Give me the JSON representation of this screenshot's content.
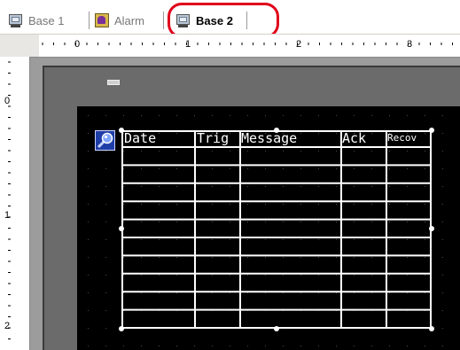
{
  "tabs": [
    {
      "label": "Base 1",
      "icon": "screen-icon",
      "active": false
    },
    {
      "label": "Alarm",
      "icon": "alarm-icon",
      "active": false
    },
    {
      "label": "Base 2",
      "icon": "screen-icon",
      "active": true
    }
  ],
  "ruler": {
    "horizontal_labels": [
      "0",
      "1",
      "2",
      "3"
    ],
    "vertical_labels": [
      "0",
      "1",
      "2"
    ]
  },
  "alarm_table": {
    "columns": [
      "Date",
      "Trig",
      "Message",
      "Ack",
      "Recov"
    ],
    "row_count": 10
  },
  "colors": {
    "highlight": "#e0001a",
    "screen_background": "#000000",
    "canvas_gray": "#6b6b6b"
  }
}
